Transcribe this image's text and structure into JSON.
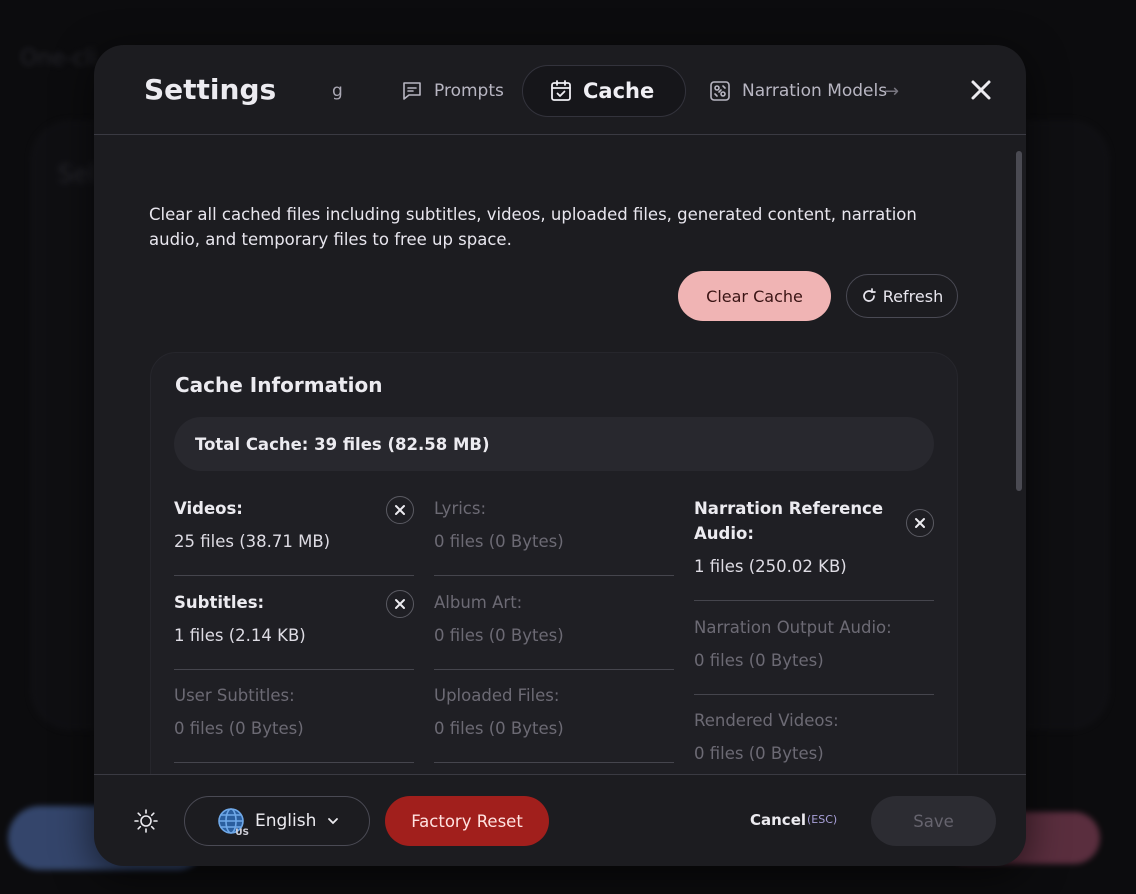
{
  "background": {
    "title_fragment": "One-cli",
    "subtitle_fragment": "Sel"
  },
  "modal": {
    "title": "Settings",
    "tab_fragment": "g",
    "tabs": [
      {
        "label": "Prompts",
        "icon": "chat-icon",
        "active": false
      },
      {
        "label": "Cache",
        "icon": "calendar-check-icon",
        "active": true
      },
      {
        "label": "Narration Models",
        "icon": "model-icon",
        "active": false
      }
    ],
    "tab_more_arrow": "→"
  },
  "cache_tab": {
    "description": "Clear all cached files including subtitles, videos, uploaded files, generated content, narration audio, and temporary files to free up space.",
    "clear_label": "Clear Cache",
    "refresh_label": "Refresh",
    "card_title": "Cache Information",
    "total": "Total Cache: 39 files (82.58 MB)",
    "items": [
      {
        "label": "Videos:",
        "value": "25 files (38.71 MB)",
        "active": true
      },
      {
        "label": "Lyrics:",
        "value": "0 files (0 Bytes)",
        "active": false
      },
      {
        "label": "Narration Reference Audio:",
        "value": "1 files (250.02 KB)",
        "active": true
      },
      {
        "label": "Subtitles:",
        "value": "1 files (2.14 KB)",
        "active": true
      },
      {
        "label": "Album Art:",
        "value": "0 files (0 Bytes)",
        "active": false
      },
      {
        "label": "Narration Output Audio:",
        "value": "0 files (0 Bytes)",
        "active": false
      },
      {
        "label": "User Subtitles:",
        "value": "0 files (0 Bytes)",
        "active": false
      },
      {
        "label": "Uploaded Files:",
        "value": "0 files (0 Bytes)",
        "active": false
      },
      {
        "label": "Rendered Videos:",
        "value": "0 files (0 Bytes)",
        "active": false
      }
    ]
  },
  "footer": {
    "language": "English",
    "language_flag_code": "US",
    "factory_reset_label": "Factory Reset",
    "cancel_label": "Cancel",
    "cancel_hint": "(ESC)",
    "save_label": "Save"
  },
  "colors": {
    "modal_bg": "#1c1c20",
    "clear_button": "#f0b4b4",
    "factory_reset": "#a11f1c",
    "esc_hint": "#a8a0d8"
  }
}
